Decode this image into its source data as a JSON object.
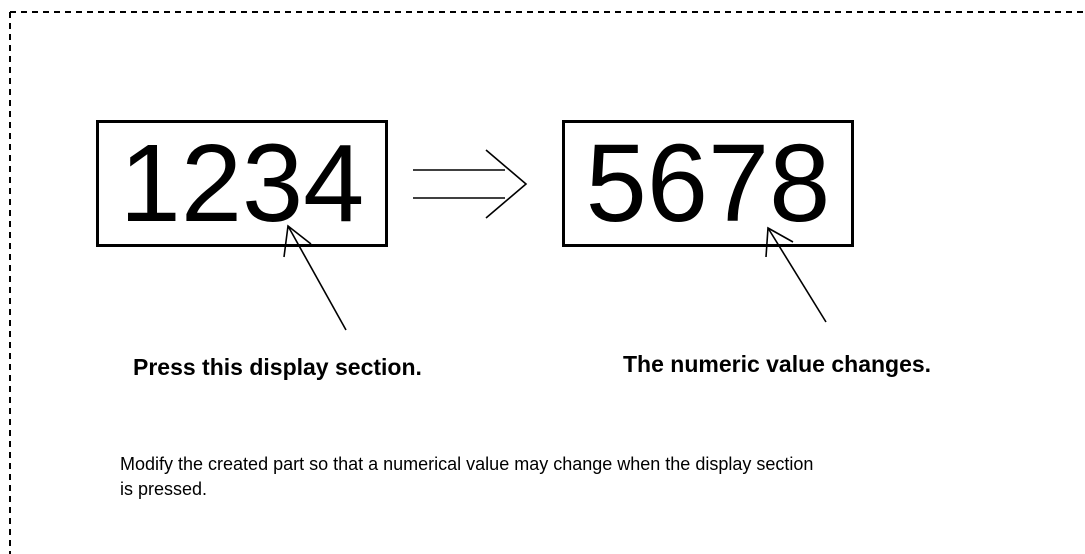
{
  "displays": {
    "before_value": "1234",
    "after_value": "5678"
  },
  "captions": {
    "press": "Press this display section.",
    "change": "The numeric value changes."
  },
  "description": "Modify the created part so that a numerical value may change when the display section is pressed.",
  "icons": {
    "transition_arrow": "double-right-arrow-icon",
    "pointer_arrows": "pointer-arrow-icon"
  },
  "colors": {
    "stroke": "#000000",
    "background": "#ffffff"
  }
}
